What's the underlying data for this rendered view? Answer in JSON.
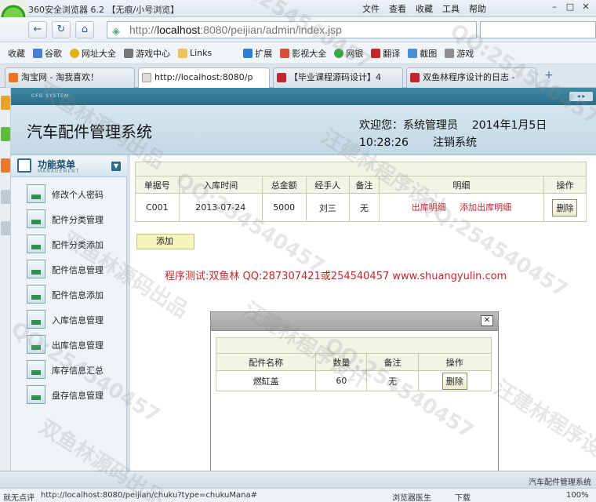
{
  "browser": {
    "title": "360安全浏览器 6.2 【无痕/小号浏览】",
    "menus": [
      "文件",
      "查看",
      "收藏",
      "工具",
      "帮助"
    ],
    "url_prefix": "http://",
    "url_host": "localhost",
    "url_rest": ":8080/peijian/admin/index.jsp",
    "bookmarks": [
      "收藏",
      "谷歌",
      "网址大全",
      "游戏中心",
      "Links",
      "扩展",
      "影视大全",
      "网银",
      "翻译",
      "截图",
      "游戏"
    ],
    "tabs": [
      {
        "label": "淘宝网 - 淘我喜欢！",
        "color": "#f2711c"
      },
      {
        "label": "http://localhost:8080/p",
        "color": "#cccccc"
      },
      {
        "label": "【毕业课程源码设计】4",
        "color": "#c1272d"
      },
      {
        "label": "双鱼林程序设计的日志 -",
        "color": "#c1272d"
      }
    ],
    "status_url": "http://localhost:8080/peijian/chuku?type=chukuMana#",
    "status_left": "就无点评",
    "status_items": [
      "浏览器医生",
      "下载",
      "100%"
    ]
  },
  "app": {
    "topbar_text": "CFG SYSTEM",
    "system_title": "汽车配件管理系统",
    "welcome_label": "欢迎您：系统管理员",
    "date": "2014年1月5日",
    "time": "10:28:26",
    "logout": "注销系统",
    "footer": "汽车配件管理系统"
  },
  "sidebar": {
    "title": "功能菜单",
    "subtitle": "MANAGEMENT",
    "items": [
      {
        "label": "修改个人密码"
      },
      {
        "label": "配件分类管理"
      },
      {
        "label": "配件分类添加"
      },
      {
        "label": "配件信息管理"
      },
      {
        "label": "配件信息添加"
      },
      {
        "label": "入库信息管理"
      },
      {
        "label": "出库信息管理"
      },
      {
        "label": "库存信息汇总"
      },
      {
        "label": "盘存信息管理"
      }
    ]
  },
  "main": {
    "columns": [
      "单据号",
      "入库时间",
      "总金额",
      "经手人",
      "备注",
      "明细",
      "操作"
    ],
    "rows": [
      {
        "id": "C001",
        "time": "2013-07-24",
        "amount": "5000",
        "handler": "刘三",
        "note": "无",
        "detail_link1": "出库明细",
        "detail_link2": "添加出库明细",
        "action": "删除"
      }
    ],
    "add_button": "添加",
    "notice": "程序测试:双鱼林 QQ:287307421或254540457 www.shuangyulin.com"
  },
  "dialog": {
    "close": "✕",
    "columns": [
      "配件名称",
      "数量",
      "备注",
      "操作"
    ],
    "rows": [
      {
        "name": "燃缸盖",
        "qty": "60",
        "note": "无",
        "action": "删除"
      }
    ]
  },
  "watermarks": [
    "QQ:254540457",
    "汪建林程序设计",
    "双鱼林源码出品"
  ]
}
